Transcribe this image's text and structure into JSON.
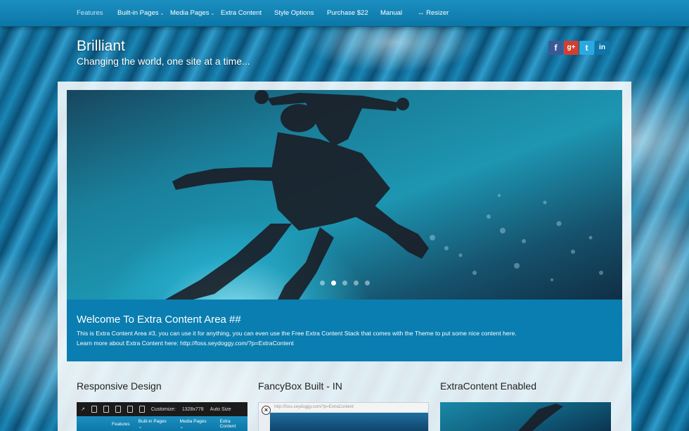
{
  "nav": {
    "items": [
      {
        "label": "Features",
        "has_caret": false
      },
      {
        "label": "Built-in Pages",
        "has_caret": true
      },
      {
        "label": "Media Pages",
        "has_caret": true
      },
      {
        "label": "Extra Content",
        "has_caret": false
      },
      {
        "label": "Style Options",
        "has_caret": false
      },
      {
        "label": "Purchase $22",
        "has_caret": false
      },
      {
        "label": "Manual",
        "has_caret": false
      },
      {
        "label": "↔ Resizer",
        "has_caret": false
      }
    ],
    "active": "Features",
    "bar_color": "#0c77a8"
  },
  "header": {
    "title": "Brilliant",
    "tagline": "Changing the world, one site at a time..."
  },
  "social": [
    {
      "icon": "facebook-icon",
      "glyph": "f",
      "color": "#3b5a98"
    },
    {
      "icon": "google-plus-icon",
      "glyph": "g+",
      "color": "#d23f31"
    },
    {
      "icon": "twitter-icon",
      "glyph": "t",
      "color": "#2aa9e0"
    },
    {
      "icon": "linkedin-icon",
      "glyph": "in",
      "color": "#0e76a8"
    }
  ],
  "slider": {
    "slide_count": 5,
    "active_slide": 2
  },
  "extra_content": {
    "heading": "Welcome To Extra Content Area ##",
    "line1": "This is Extra Content Area #3, you can use it for anything, you can even use the Free Extra Content Stack that comes with the Theme to put some nice content here.",
    "line2": "Learn more about Extra Content here: http://foss.seydoggy.com/?p=ExtraContent",
    "color": "#0a7eb1"
  },
  "features": [
    {
      "title": "Responsive Design",
      "thumb": {
        "customize_label": "Customize:",
        "size_readout": "1328x778",
        "auto_size": "Auto Size",
        "size_label": "Size: 1328",
        "nav": [
          "Features",
          "Built-in Pages ⌄",
          "Media Pages ⌄",
          "Extra Content"
        ]
      }
    },
    {
      "title": "FancyBox Built - IN",
      "thumb": {
        "url": "http://foss.seydoggy.com/?p=ExtraContent",
        "close_glyph": "×"
      }
    },
    {
      "title": "ExtraContent Enabled"
    }
  ]
}
